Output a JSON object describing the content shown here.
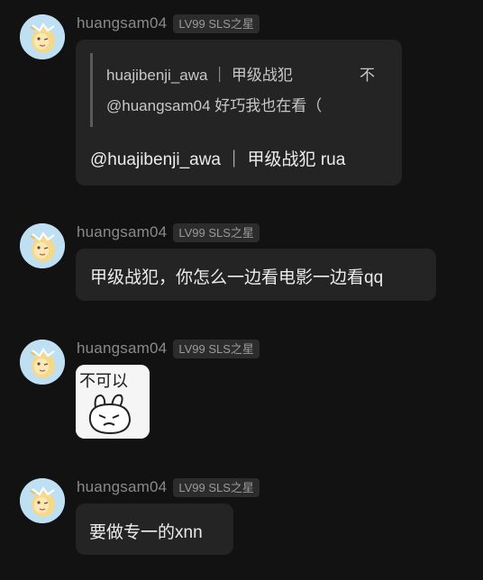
{
  "messages": [
    {
      "username": "huangsam04",
      "badge": "LV99 SLS之星",
      "quote": {
        "line1": "huajibenji_awa ｜ 甲级战犯",
        "line1_tail": "不",
        "line2": "@huangsam04 好巧我也在看（"
      },
      "text": "@huajibenji_awa ｜ 甲级战犯 rua"
    },
    {
      "username": "huangsam04",
      "badge": "LV99 SLS之星",
      "text": "甲级战犯，你怎么一边看电影一边看qq"
    },
    {
      "username": "huangsam04",
      "badge": "LV99 SLS之星",
      "sticker": {
        "text": "不可以",
        "icon": "angry-bunny-sticker"
      }
    },
    {
      "username": "huangsam04",
      "badge": "LV99 SLS之星",
      "text": "要做专一的xnn"
    }
  ],
  "colors": {
    "background": "#121212",
    "bubble": "#242424",
    "username": "#8a8a8a",
    "badge_bg": "#2c2c2c"
  }
}
